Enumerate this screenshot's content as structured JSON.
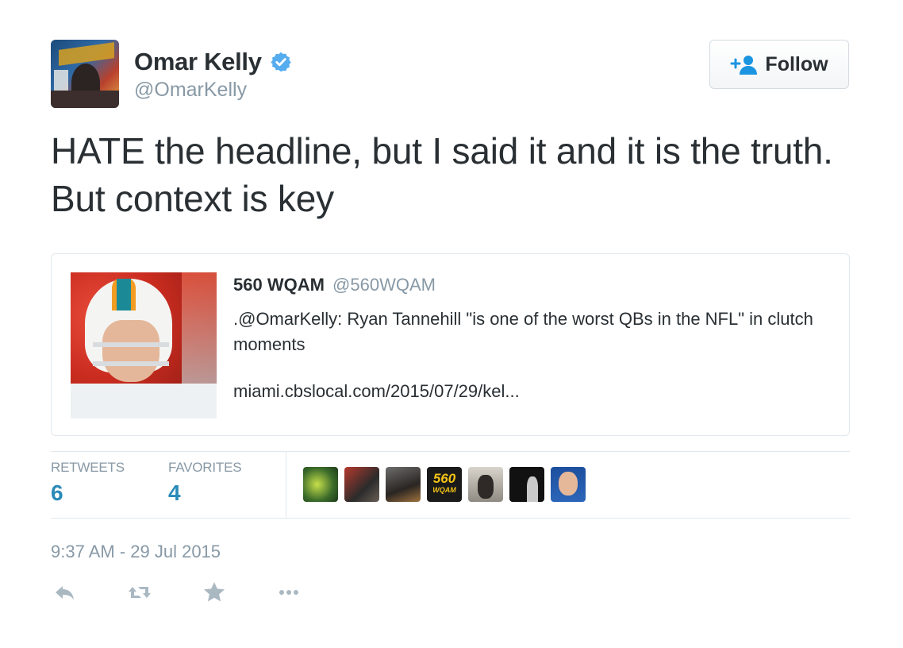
{
  "author": {
    "name": "Omar Kelly",
    "handle": "@OmarKelly",
    "verified": true
  },
  "follow_button": {
    "label": "Follow",
    "icon": "add-person-icon"
  },
  "tweet": {
    "text": "HATE the headline, but I said it and it is the truth. But context is key",
    "timestamp": "9:37 AM - 29 Jul 2015"
  },
  "quoted_tweet": {
    "name": "560 WQAM",
    "handle": "@560WQAM",
    "text": ".@OmarKelly: Ryan Tannehill \"is one of the worst QBs in the NFL\" in clutch moments",
    "link": "miami.cbslocal.com/2015/07/29/kel..."
  },
  "stats": {
    "retweets_label": "RETWEETS",
    "retweets_value": "6",
    "favorites_label": "FAVORITES",
    "favorites_value": "4"
  },
  "favorited_by": {
    "avatar4_text": "560 WQAM"
  },
  "actions": {
    "reply": "reply-icon",
    "retweet": "retweet-icon",
    "favorite": "star-icon",
    "more": "more-icon"
  },
  "colors": {
    "text": "#292f33",
    "muted": "#8899a6",
    "verified": "#55acee",
    "stat_value": "#2a8ab8",
    "border": "#e1e8ed"
  }
}
